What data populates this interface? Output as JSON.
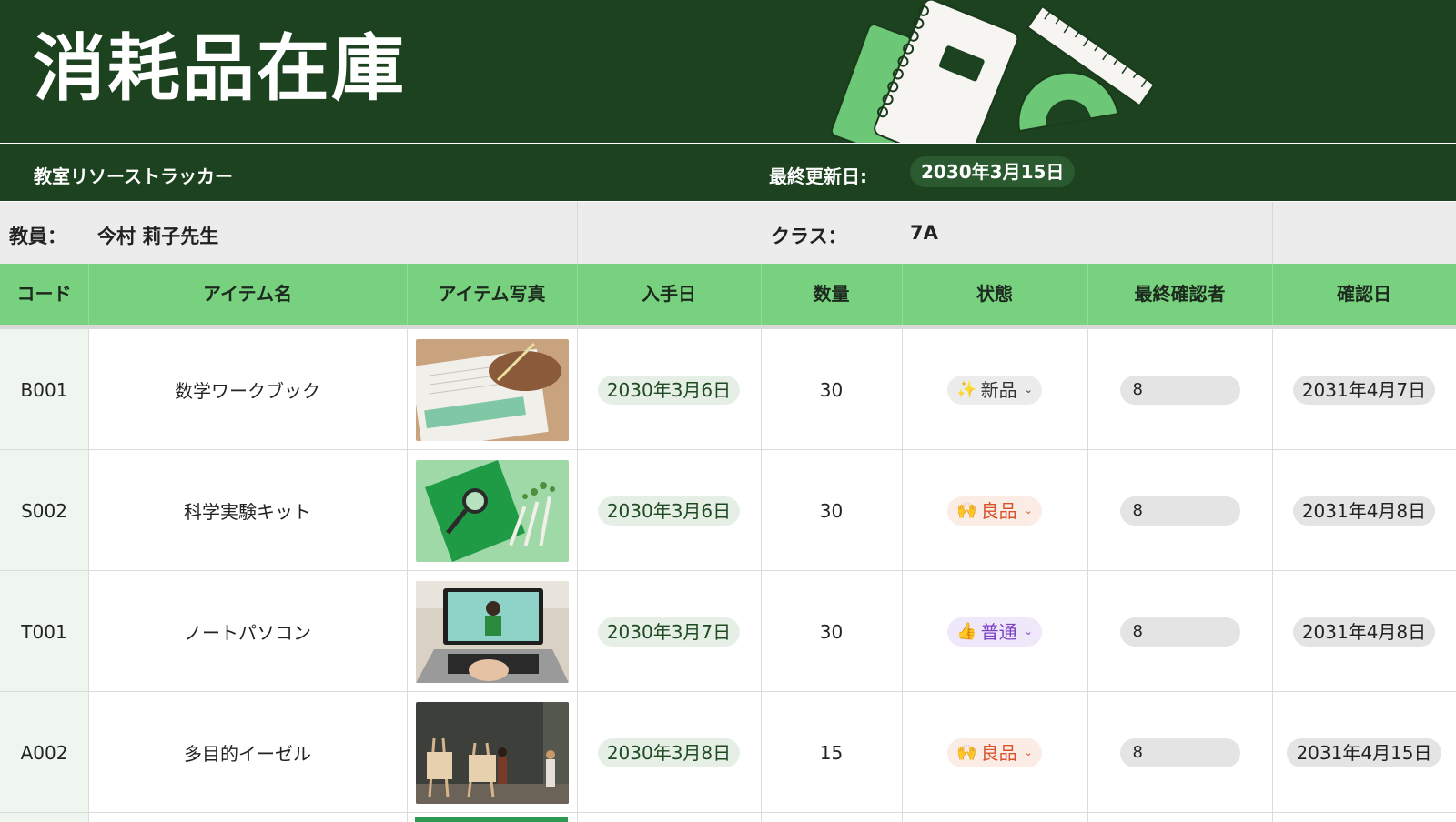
{
  "header": {
    "title": "消耗品在庫",
    "subtitle": "教室リソーストラッカー",
    "last_updated_label": "最終更新日:",
    "last_updated_value": "2030年3月15日"
  },
  "info": {
    "teacher_label": "教員：",
    "teacher_value": "今村 莉子先生",
    "class_label": "クラス：",
    "class_value": "7A"
  },
  "columns": [
    "コード",
    "アイテム名",
    "アイテム写真",
    "入手日",
    "数量",
    "状態",
    "最終確認者",
    "確認日"
  ],
  "rows": [
    {
      "code": "B001",
      "name": "数学ワークブック",
      "photo": "workbook-photo",
      "acquired": "2030年3月6日",
      "qty": "30",
      "status": "新品",
      "status_icon": "✨",
      "checker": "8",
      "checked": "2031年4月7日"
    },
    {
      "code": "S002",
      "name": "科学実験キット",
      "photo": "science-kit-photo",
      "acquired": "2030年3月6日",
      "qty": "30",
      "status": "良品",
      "status_icon": "🙌",
      "checker": "8",
      "checked": "2031年4月8日"
    },
    {
      "code": "T001",
      "name": "ノートパソコン",
      "photo": "laptop-photo",
      "acquired": "2030年3月7日",
      "qty": "30",
      "status": "普通",
      "status_icon": "👍",
      "checker": "8",
      "checked": "2031年4月8日"
    },
    {
      "code": "A002",
      "name": "多目的イーゼル",
      "photo": "easel-photo",
      "acquired": "2030年3月8日",
      "qty": "15",
      "status": "良品",
      "status_icon": "🙌",
      "checker": "8",
      "checked": "2031年4月15日"
    }
  ],
  "colors": {
    "banner": "#1c421f",
    "header_green": "#77d17f",
    "status_new": "#ececec",
    "status_good": "#d8542d",
    "status_ok": "#7b3fc5"
  }
}
